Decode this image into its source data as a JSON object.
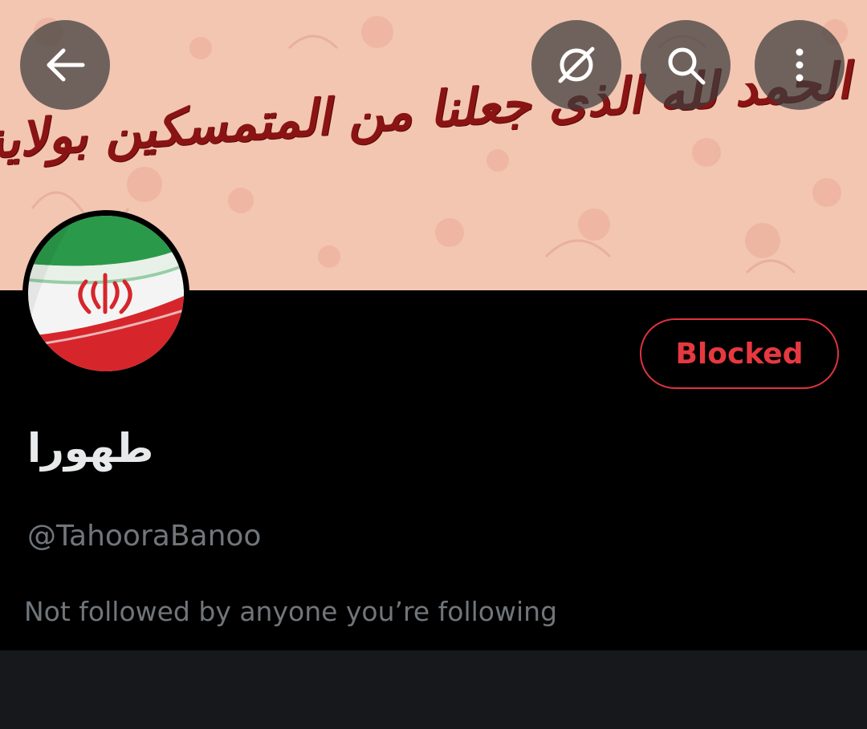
{
  "header": {
    "banner_calligraphy": "الحمد لله الذی جعلنا من المتمسکین بولایة امیرالمؤمنین",
    "back_icon": "arrow-left-icon",
    "grok_icon": "grok-icon",
    "search_icon": "search-icon",
    "more_icon": "more-vertical-icon"
  },
  "profile": {
    "avatar_icon": "iran-flag-avatar",
    "display_name": "طهورا",
    "handle": "@TahooraBanoo",
    "followers_note": "Not followed by anyone you’re following",
    "blocked_label": "Blocked"
  },
  "colors": {
    "background": "#000000",
    "banner": "#f2c4b0",
    "calligraphy": "#8a1414",
    "blocked_red": "#e0333d",
    "secondary_text": "#71767b",
    "primary_text": "#e7e9ea",
    "bottom_strip": "#16181c"
  }
}
